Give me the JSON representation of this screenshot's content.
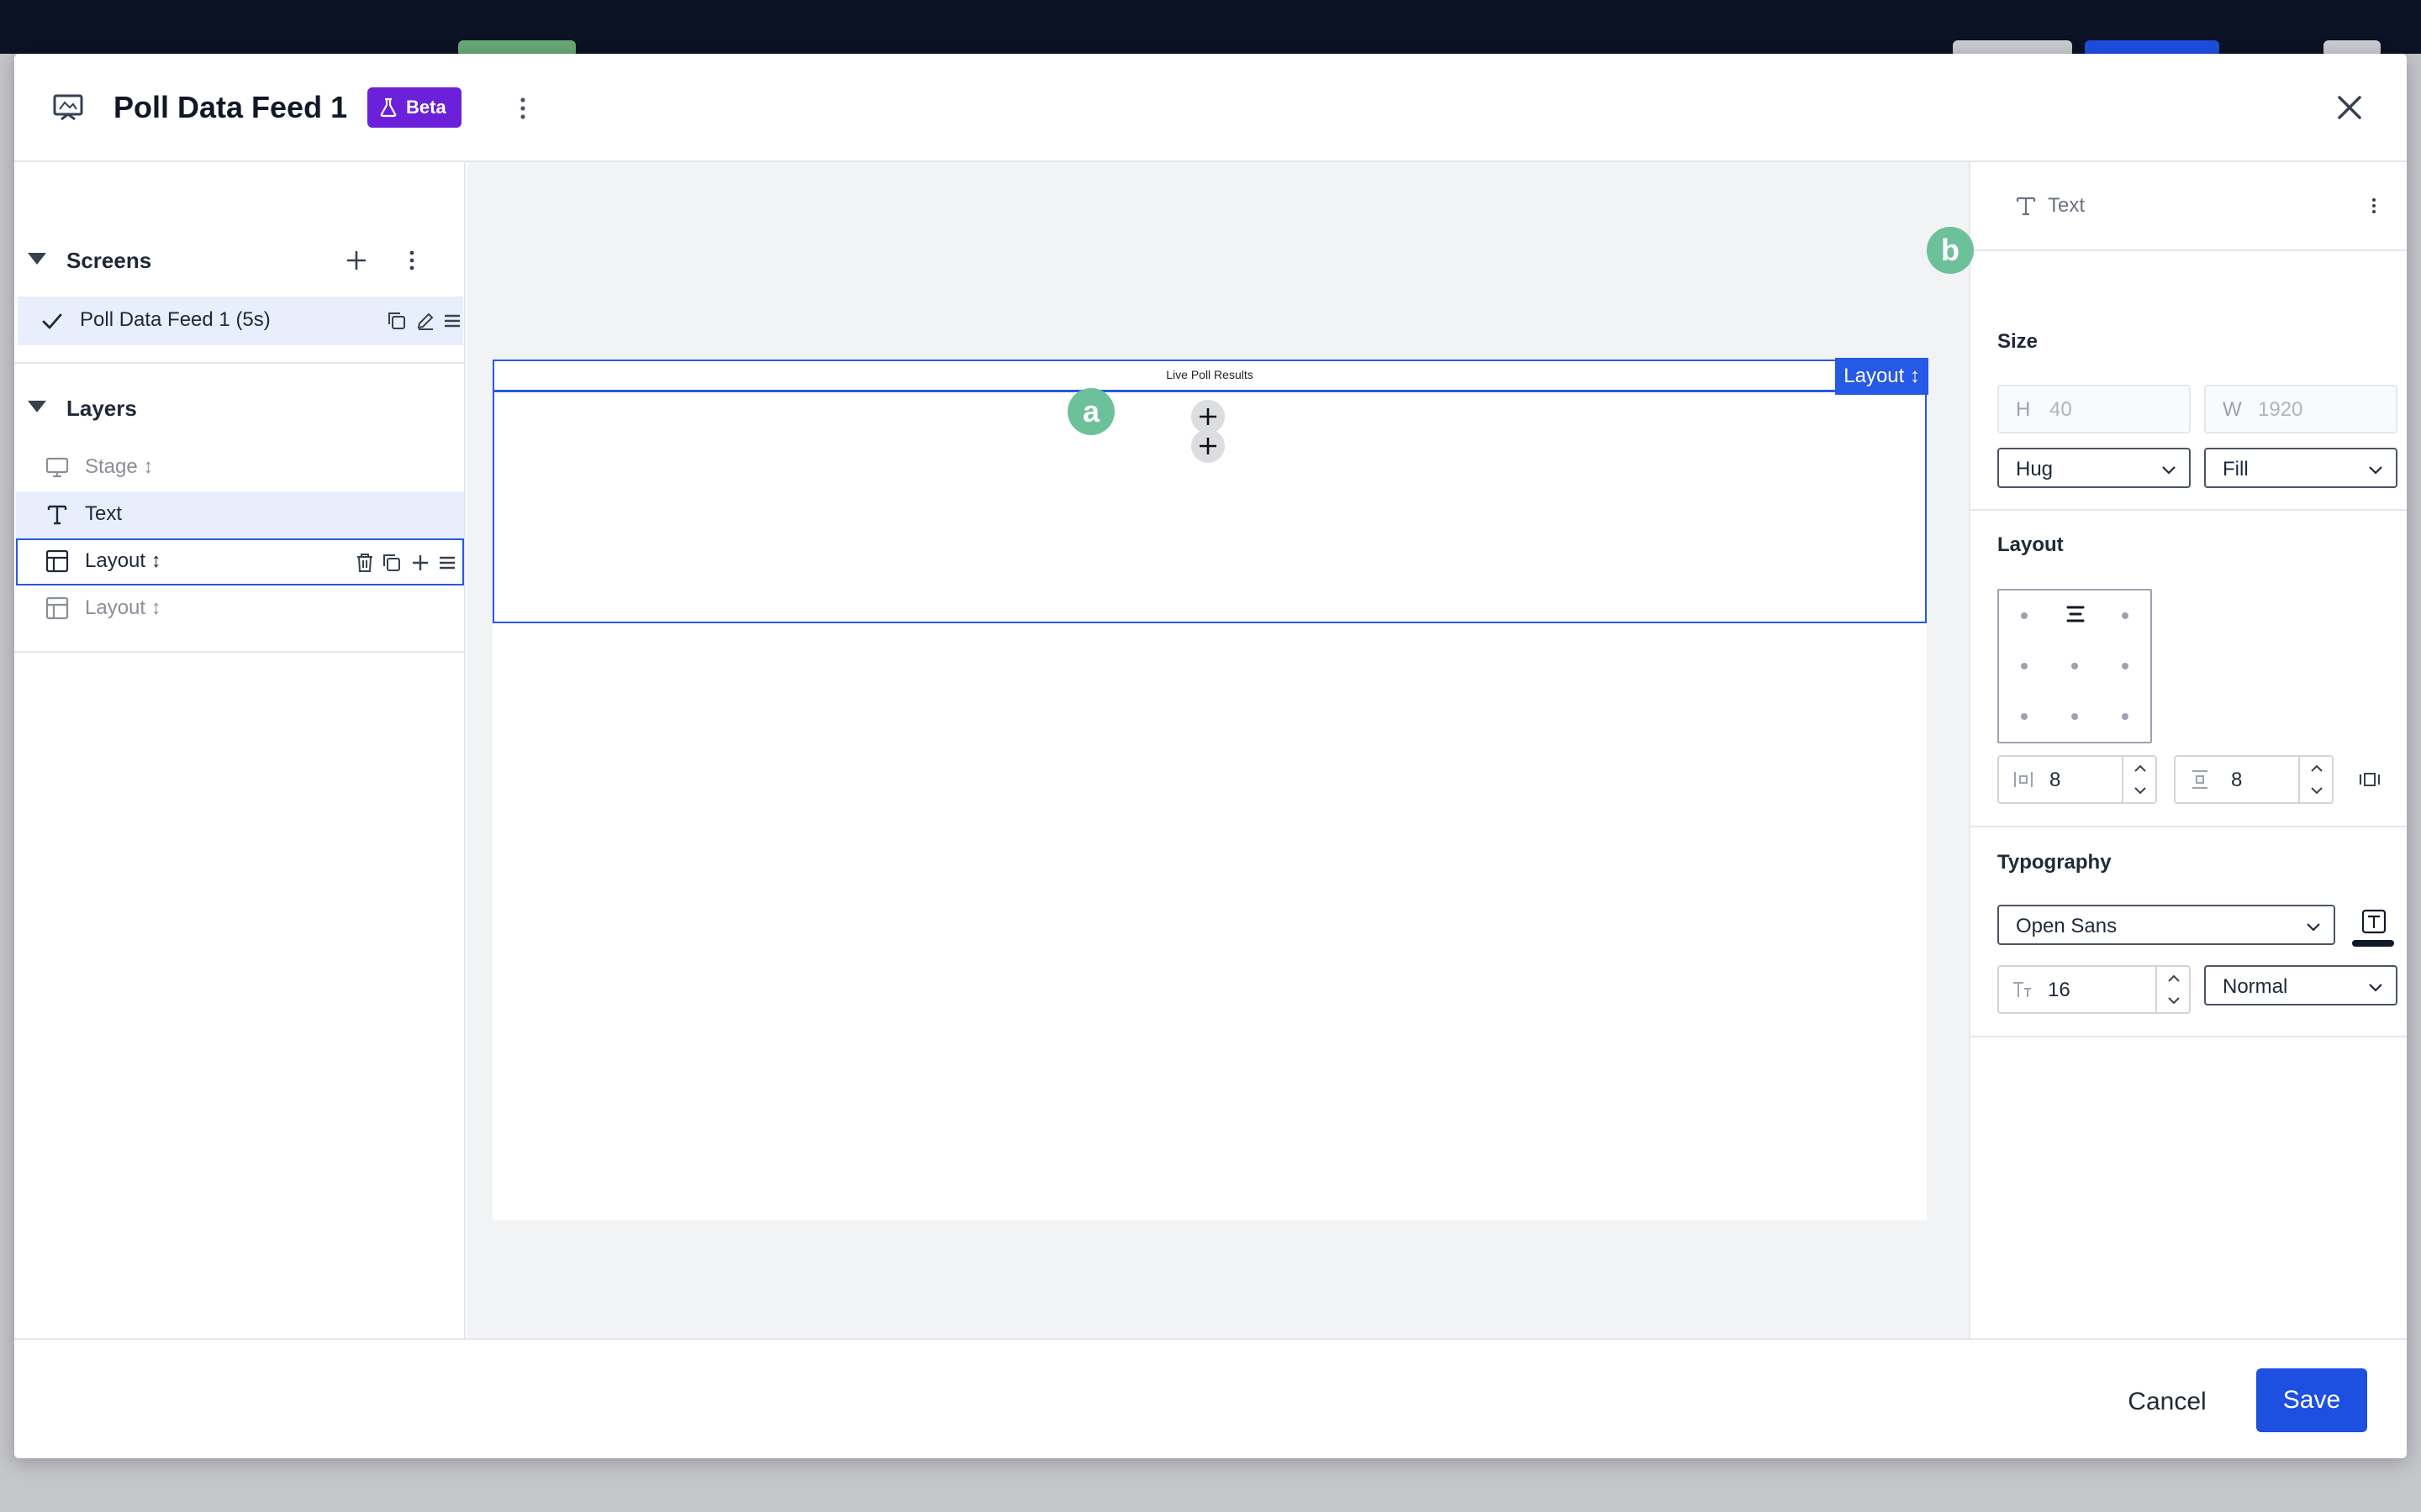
{
  "modal": {
    "title": "Poll Data Feed 1",
    "badge": "Beta"
  },
  "screens": {
    "title": "Screens",
    "items": [
      {
        "label": "Poll Data Feed 1 (5s)",
        "selected": true
      }
    ]
  },
  "layers": {
    "title": "Layers",
    "items": [
      {
        "label": "Stage ↕",
        "icon": "monitor-icon",
        "muted": true
      },
      {
        "label": "Text",
        "icon": "text-icon",
        "selected": true
      },
      {
        "label": "Layout ↕",
        "icon": "layout-icon",
        "outlined": true
      },
      {
        "label": "Layout ↕",
        "icon": "layout-icon",
        "muted": true
      }
    ]
  },
  "canvas": {
    "text_content": "Live Poll Results",
    "layout_tag": "Layout ↕",
    "markers": [
      "a",
      "b"
    ]
  },
  "properties": {
    "element_type": "Text",
    "size": {
      "title": "Size",
      "height_prefix": "H",
      "height_value": "40",
      "width_prefix": "W",
      "width_value": "1920",
      "height_mode": "Hug",
      "width_mode": "Fill"
    },
    "layout": {
      "title": "Layout",
      "gap_horizontal": "8",
      "gap_vertical": "8"
    },
    "typography": {
      "title": "Typography",
      "font": "Open Sans",
      "font_size": "16",
      "weight": "Normal"
    }
  },
  "footer": {
    "cancel": "Cancel",
    "save": "Save"
  },
  "colors": {
    "accent": "#2559e6",
    "beta": "#6b21d9",
    "marker": "#6cc19a"
  }
}
